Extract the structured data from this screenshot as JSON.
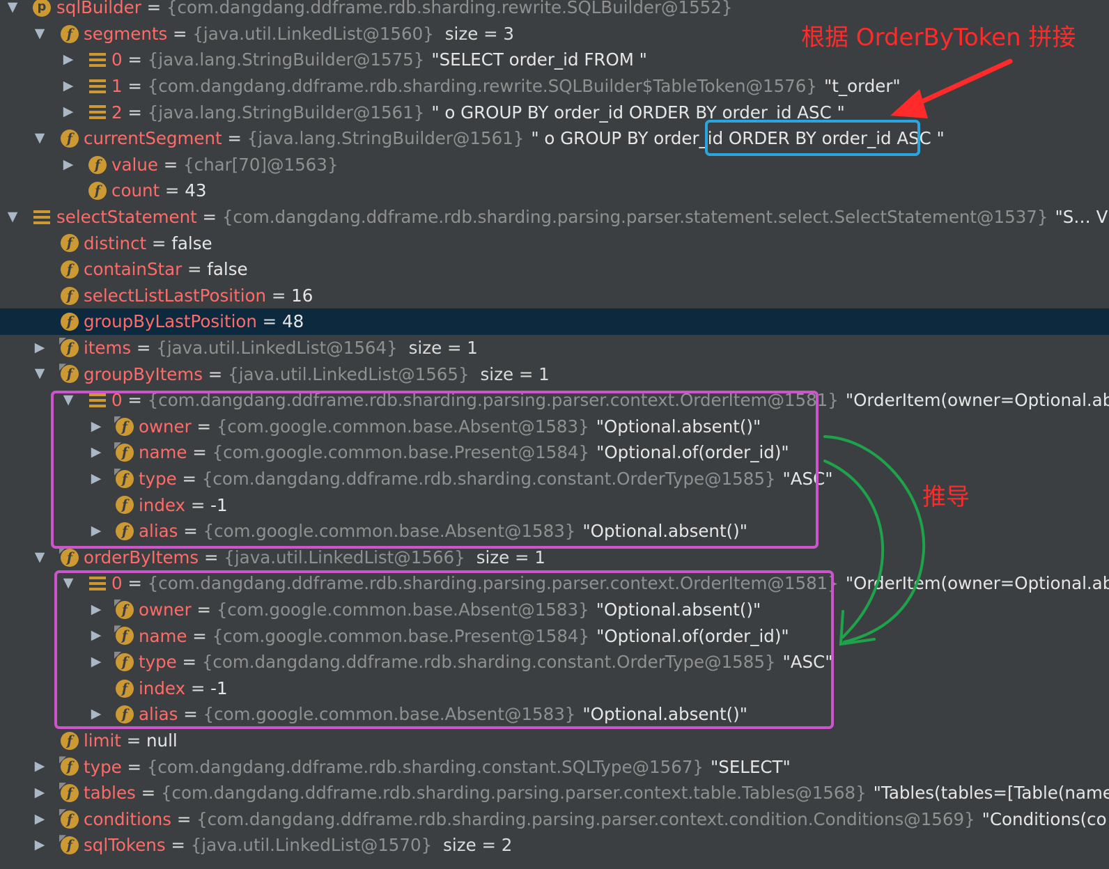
{
  "rows": [
    {
      "arrow": "▼",
      "icon": "p",
      "name": "sqlBuilder",
      "type": "{com.dangdang.ddframe.rdb.sharding.rewrite.SQLBuilder@1552}",
      "str": "",
      "size": ""
    },
    {
      "arrow": "▼",
      "icon": "f",
      "name": "segments",
      "type": "{java.util.LinkedList@1560}",
      "str": "",
      "size": "size = 3"
    },
    {
      "arrow": "▶",
      "icon": "arr",
      "name": "0",
      "type": "{java.lang.StringBuilder@1575}",
      "str": "\"SELECT order_id FROM \"",
      "size": ""
    },
    {
      "arrow": "▶",
      "icon": "arr",
      "name": "1",
      "type": "{com.dangdang.ddframe.rdb.sharding.rewrite.SQLBuilder$TableToken@1576}",
      "str": "\"t_order\"",
      "size": ""
    },
    {
      "arrow": "▶",
      "icon": "arr",
      "name": "2",
      "type": "{java.lang.StringBuilder@1561}",
      "str": "\" o GROUP BY order_id ORDER BY order_id ASC \"",
      "size": ""
    },
    {
      "arrow": "▼",
      "icon": "f",
      "name": "currentSegment",
      "type": "{java.lang.StringBuilder@1561}",
      "str": "\" o GROUP BY order_id ORDER BY order_id ASC \"",
      "size": ""
    },
    {
      "arrow": "▶",
      "icon": "f",
      "name": "value",
      "type": "{char[70]@1563}",
      "str": "",
      "size": ""
    },
    {
      "arrow": "",
      "icon": "f",
      "name": "count",
      "type": "",
      "str": "43",
      "size": ""
    },
    {
      "arrow": "▼",
      "icon": "arr",
      "name": "selectStatement",
      "type": "{com.dangdang.ddframe.rdb.sharding.parsing.parser.statement.select.SelectStatement@1537}",
      "str": "\"S… View",
      "size": ""
    },
    {
      "arrow": "",
      "icon": "f",
      "name": "distinct",
      "type": "",
      "str": "false",
      "size": ""
    },
    {
      "arrow": "",
      "icon": "f",
      "name": "containStar",
      "type": "",
      "str": "false",
      "size": ""
    },
    {
      "arrow": "",
      "icon": "f",
      "name": "selectListLastPosition",
      "type": "",
      "str": "16",
      "size": ""
    },
    {
      "arrow": "",
      "icon": "f",
      "name": "groupByLastPosition",
      "type": "",
      "str": "48",
      "size": ""
    },
    {
      "arrow": "▶",
      "icon": "fp",
      "name": "items",
      "type": "{java.util.LinkedList@1564}",
      "str": "",
      "size": "size = 1"
    },
    {
      "arrow": "▼",
      "icon": "fp",
      "name": "groupByItems",
      "type": "{java.util.LinkedList@1565}",
      "str": "",
      "size": "size = 1"
    },
    {
      "arrow": "▼",
      "icon": "arr",
      "name": "0",
      "type": "{com.dangdang.ddframe.rdb.sharding.parsing.parser.context.OrderItem@1581}",
      "str": "\"OrderItem(owner=Optional.abse",
      "size": ""
    },
    {
      "arrow": "▶",
      "icon": "fp",
      "name": "owner",
      "type": "{com.google.common.base.Absent@1583}",
      "str": "\"Optional.absent()\"",
      "size": ""
    },
    {
      "arrow": "▶",
      "icon": "fp",
      "name": "name",
      "type": "{com.google.common.base.Present@1584}",
      "str": "\"Optional.of(order_id)\"",
      "size": ""
    },
    {
      "arrow": "▶",
      "icon": "fp",
      "name": "type",
      "type": "{com.dangdang.ddframe.rdb.sharding.constant.OrderType@1585}",
      "str": "\"ASC\"",
      "size": ""
    },
    {
      "arrow": "",
      "icon": "f",
      "name": "index",
      "type": "",
      "str": "-1",
      "size": ""
    },
    {
      "arrow": "▶",
      "icon": "f",
      "name": "alias",
      "type": "{com.google.common.base.Absent@1583}",
      "str": "\"Optional.absent()\"",
      "size": ""
    },
    {
      "arrow": "▼",
      "icon": "fp",
      "name": "orderByItems",
      "type": "{java.util.LinkedList@1566}",
      "str": "",
      "size": "size = 1"
    },
    {
      "arrow": "▼",
      "icon": "arr",
      "name": "0",
      "type": "{com.dangdang.ddframe.rdb.sharding.parsing.parser.context.OrderItem@1581}",
      "str": "\"OrderItem(owner=Optional.abse",
      "size": ""
    },
    {
      "arrow": "▶",
      "icon": "fp",
      "name": "owner",
      "type": "{com.google.common.base.Absent@1583}",
      "str": "\"Optional.absent()\"",
      "size": ""
    },
    {
      "arrow": "▶",
      "icon": "fp",
      "name": "name",
      "type": "{com.google.common.base.Present@1584}",
      "str": "\"Optional.of(order_id)\"",
      "size": ""
    },
    {
      "arrow": "▶",
      "icon": "fp",
      "name": "type",
      "type": "{com.dangdang.ddframe.rdb.sharding.constant.OrderType@1585}",
      "str": "\"ASC\"",
      "size": ""
    },
    {
      "arrow": "",
      "icon": "f",
      "name": "index",
      "type": "",
      "str": "-1",
      "size": ""
    },
    {
      "arrow": "▶",
      "icon": "f",
      "name": "alias",
      "type": "{com.google.common.base.Absent@1583}",
      "str": "\"Optional.absent()\"",
      "size": ""
    },
    {
      "arrow": "",
      "icon": "f",
      "name": "limit",
      "type": "",
      "str": "null",
      "size": ""
    },
    {
      "arrow": "▶",
      "icon": "fp",
      "name": "type",
      "type": "{com.dangdang.ddframe.rdb.sharding.constant.SQLType@1567}",
      "str": "\"SELECT\"",
      "size": ""
    },
    {
      "arrow": "▶",
      "icon": "fp",
      "name": "tables",
      "type": "{com.dangdang.ddframe.rdb.sharding.parsing.parser.context.table.Tables@1568}",
      "str": "\"Tables(tables=[Table(name=",
      "size": ""
    },
    {
      "arrow": "▶",
      "icon": "fp",
      "name": "conditions",
      "type": "{com.dangdang.ddframe.rdb.sharding.parsing.parser.context.condition.Conditions@1569}",
      "str": "\"Conditions(co",
      "size": ""
    },
    {
      "arrow": "▶",
      "icon": "fp",
      "name": "sqlTokens",
      "type": "{java.util.LinkedList@1570}",
      "str": "",
      "size": "size = 2"
    }
  ],
  "selected_row": 12,
  "annotations": {
    "order_by_token": "根据 OrderByToken 拼接",
    "derive": "推导"
  },
  "colors": {
    "background": "#3c3f41",
    "selected": "#0d293e",
    "field_name": "#ff6b68",
    "type_text": "#8f9090",
    "blue_box": "#29a6e0",
    "magenta_box": "#cc55cc",
    "red_annotation": "#ff2a2a",
    "green_arrow": "#1ea34a"
  }
}
